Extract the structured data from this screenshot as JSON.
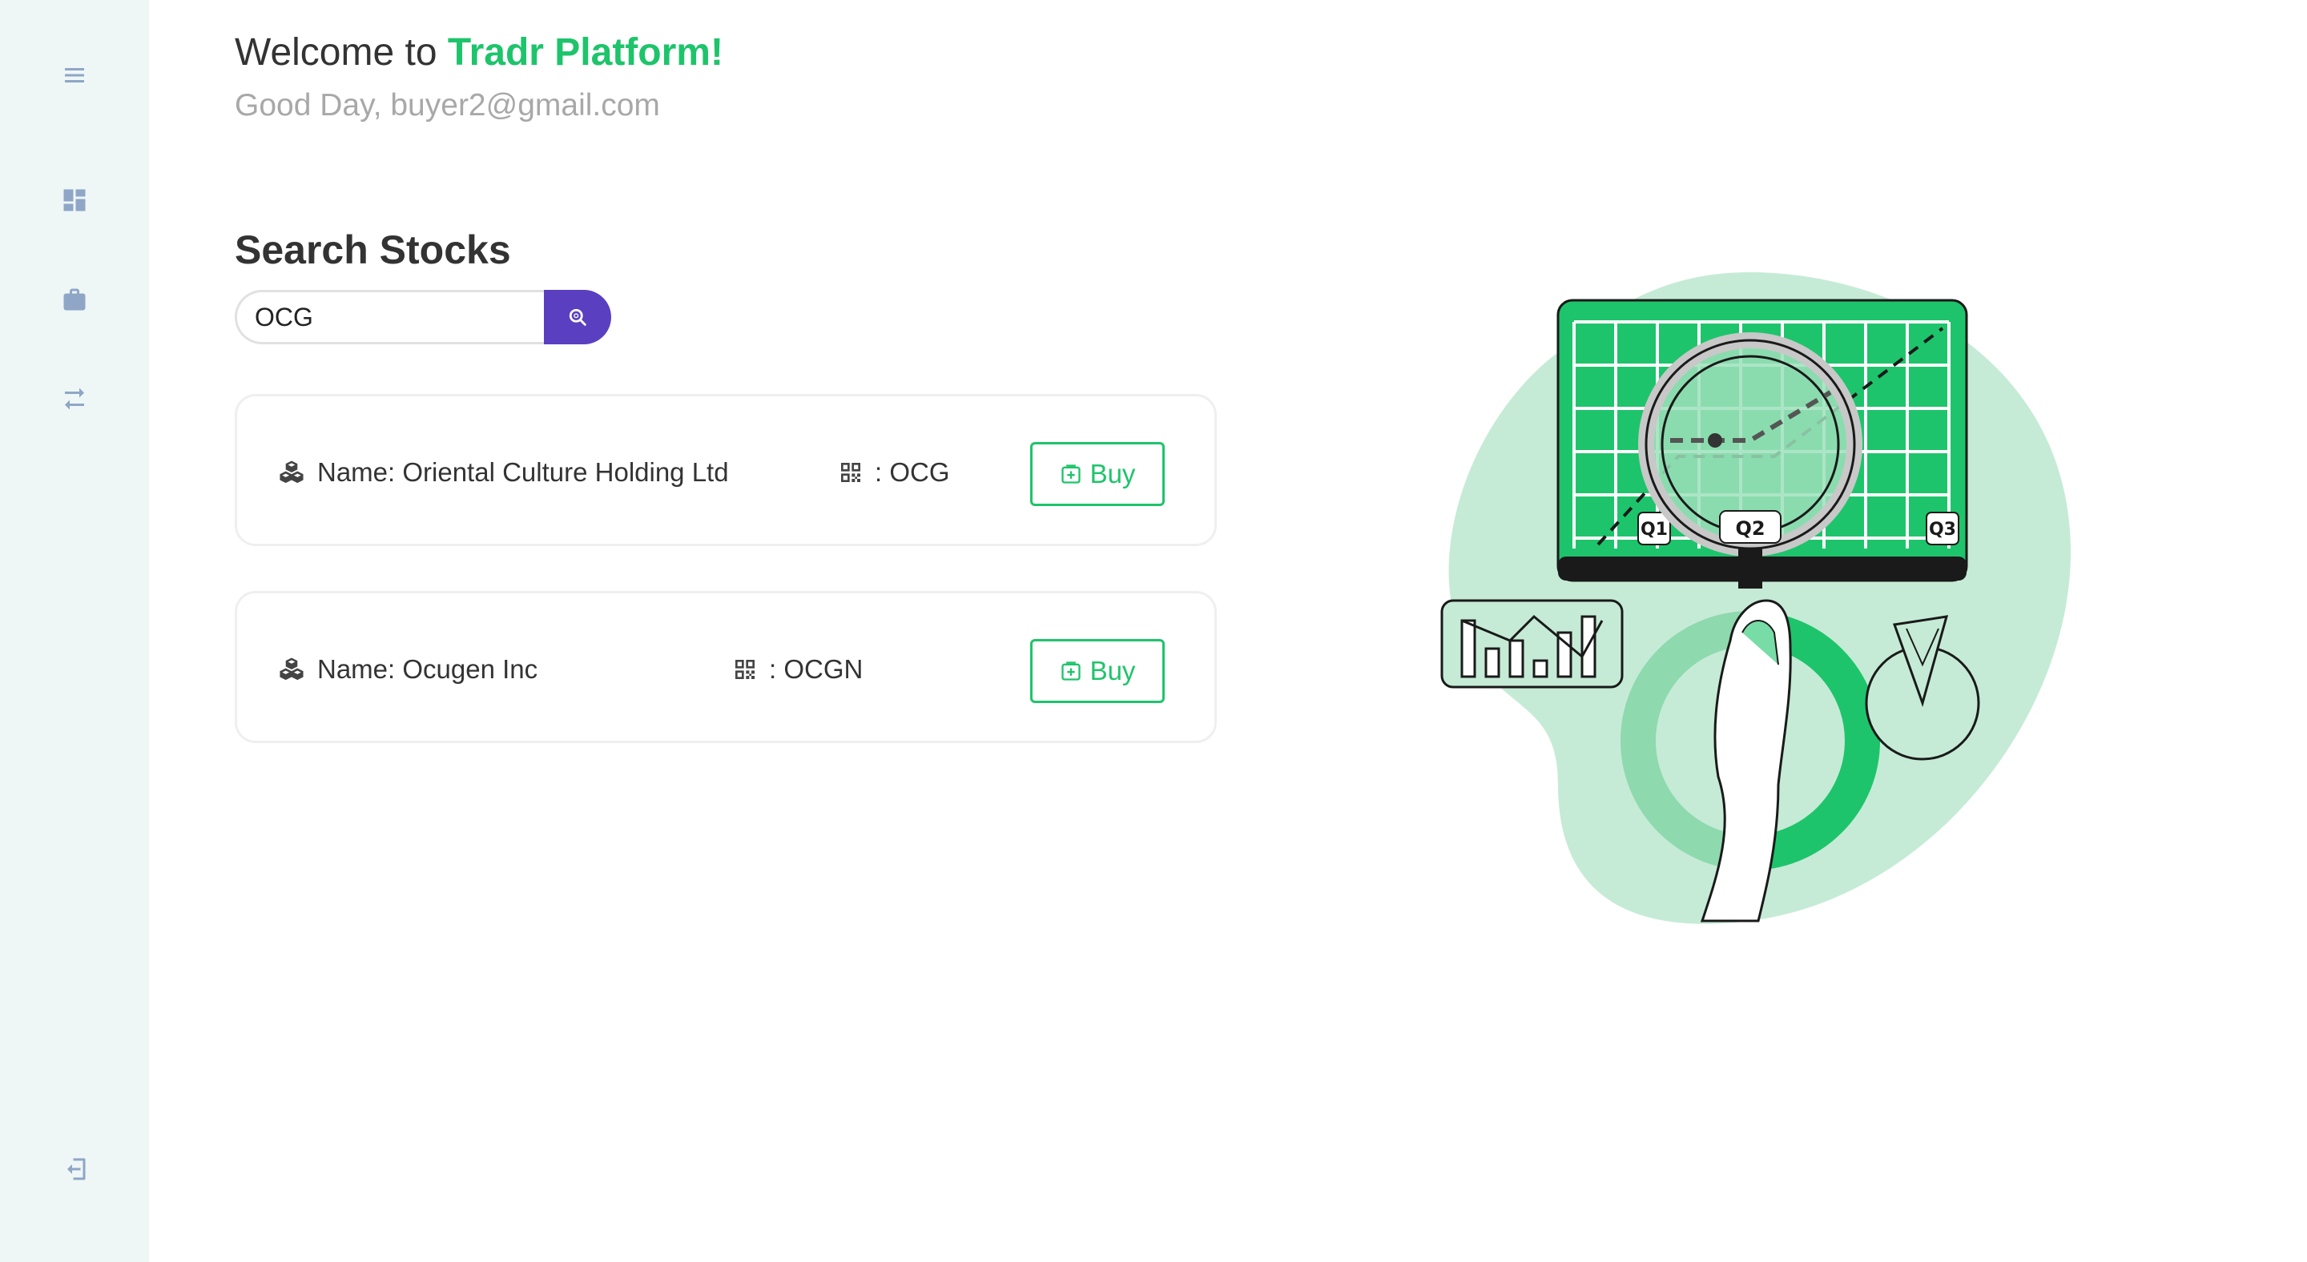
{
  "sidebar": {
    "items": [
      {
        "icon": "menu-icon"
      },
      {
        "icon": "dashboard-icon"
      },
      {
        "icon": "briefcase-icon"
      },
      {
        "icon": "transfer-icon"
      },
      {
        "icon": "logout-icon"
      }
    ],
    "background": "#eef7f6",
    "icon_color": "#8fa6c7"
  },
  "header": {
    "welcome_prefix": "Welcome to",
    "brand": "Tradr Platform!",
    "greeting": "Good Day, buyer2@gmail.com",
    "brand_color": "#1ec46b"
  },
  "search": {
    "title": "Search Stocks",
    "value": "OCG",
    "button_color": "#5a3fc0"
  },
  "results": [
    {
      "name": "Name: Oriental Culture Holding Ltd",
      "symbol": ": OCG",
      "buy_label": "Buy"
    },
    {
      "name": "Name: Ocugen Inc",
      "symbol": ": OCGN",
      "buy_label": "Buy"
    }
  ],
  "illustration": {
    "labels": [
      "Q1",
      "Q2",
      "Q3"
    ]
  }
}
